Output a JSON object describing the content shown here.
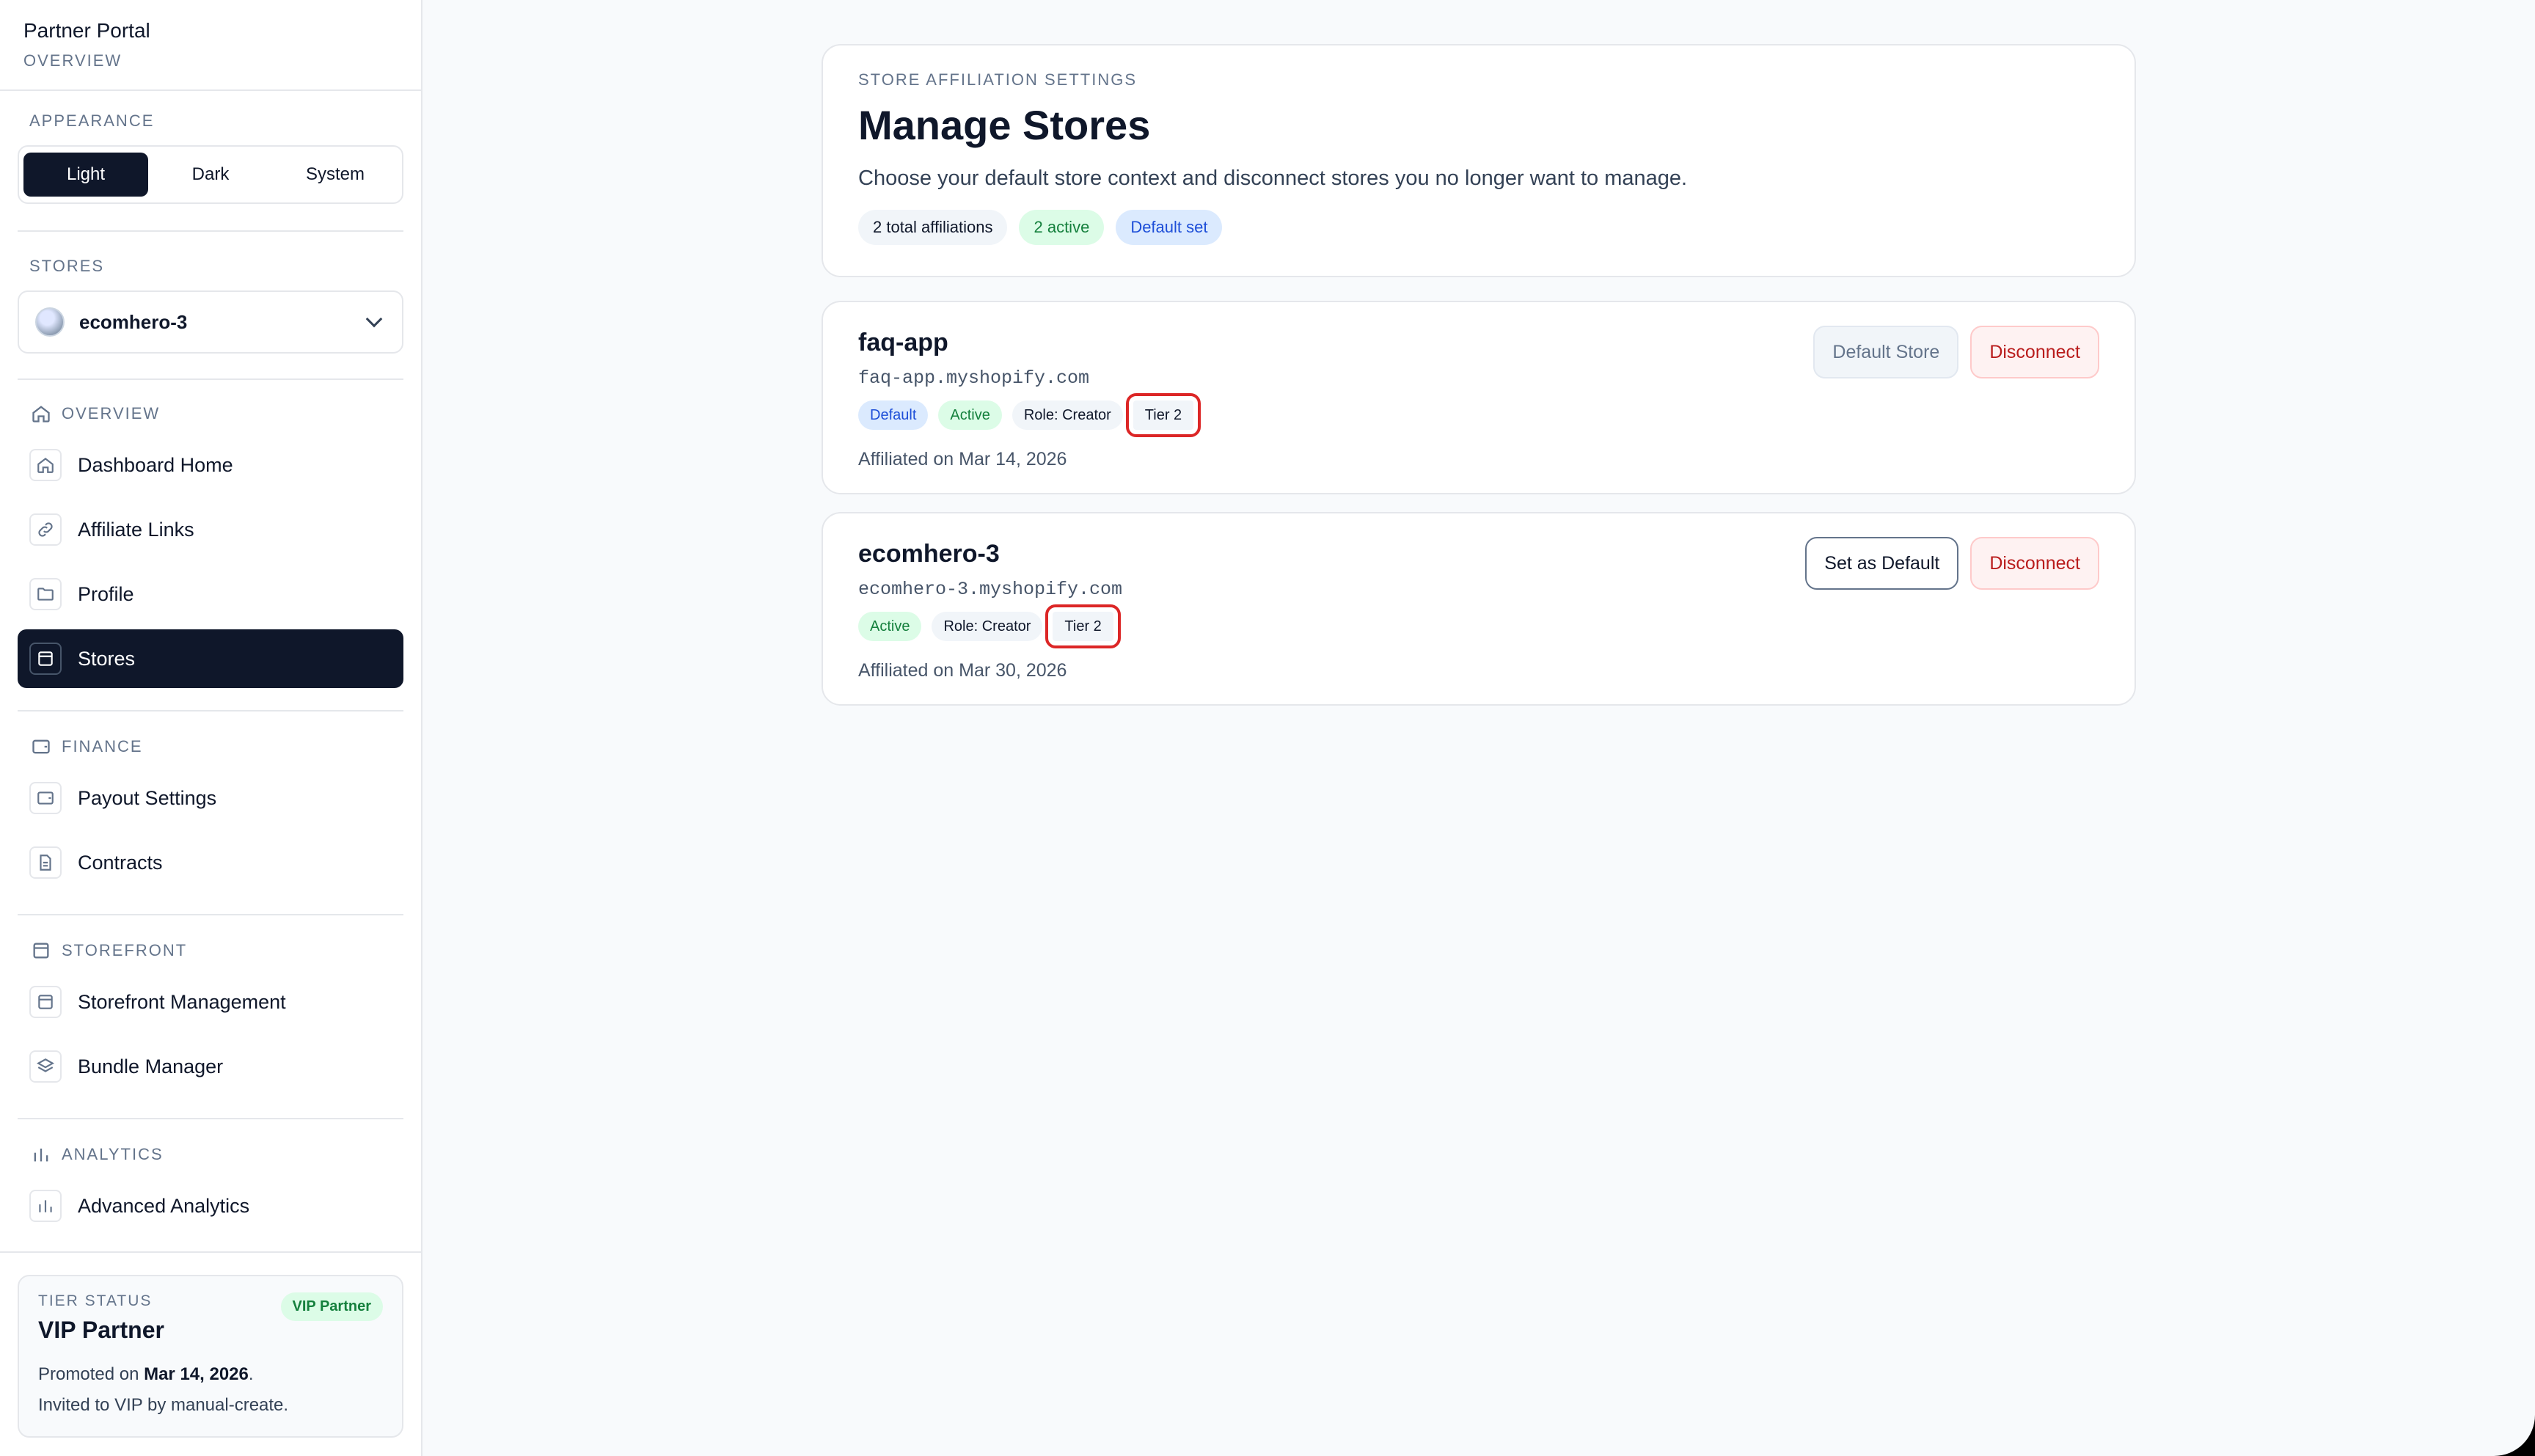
{
  "sidebar": {
    "brand_title": "Partner Portal",
    "brand_subtitle": "OVERVIEW",
    "appearance": {
      "label": "APPEARANCE",
      "options": [
        "Light",
        "Dark",
        "System"
      ],
      "selected": "Light"
    },
    "stores": {
      "label": "STORES",
      "selected": "ecomhero-3"
    },
    "groups": [
      {
        "label": "OVERVIEW",
        "icon": "home-icon",
        "items": [
          {
            "label": "Dashboard Home",
            "icon": "home-icon"
          },
          {
            "label": "Affiliate Links",
            "icon": "link-icon"
          },
          {
            "label": "Profile",
            "icon": "folder-icon"
          },
          {
            "label": "Stores",
            "icon": "store-icon",
            "active": true
          }
        ]
      },
      {
        "label": "FINANCE",
        "icon": "wallet-icon",
        "items": [
          {
            "label": "Payout Settings",
            "icon": "wallet-icon"
          },
          {
            "label": "Contracts",
            "icon": "document-icon"
          }
        ]
      },
      {
        "label": "STOREFRONT",
        "icon": "store-icon",
        "items": [
          {
            "label": "Storefront Management",
            "icon": "store-icon"
          },
          {
            "label": "Bundle Manager",
            "icon": "layers-icon"
          }
        ]
      },
      {
        "label": "ANALYTICS",
        "icon": "bar-chart-icon",
        "items": [
          {
            "label": "Advanced Analytics",
            "icon": "bar-chart-icon"
          }
        ]
      }
    ],
    "tier": {
      "label": "TIER STATUS",
      "badge": "VIP Partner",
      "name": "VIP Partner",
      "promoted_prefix": "Promoted on ",
      "promoted_date": "Mar 14, 2026",
      "promoted_suffix": ".",
      "invited": "Invited to VIP by manual-create."
    }
  },
  "header": {
    "eyebrow": "STORE AFFILIATION SETTINGS",
    "title": "Manage Stores",
    "description": "Choose your default store context and disconnect stores you no longer want to manage.",
    "chips": [
      "2 total affiliations",
      "2 active",
      "Default set"
    ]
  },
  "stores": [
    {
      "name": "faq-app",
      "domain": "faq-app.myshopify.com",
      "badges": {
        "default": "Default",
        "status": "Active",
        "role": "Role: Creator",
        "tier": "Tier 2"
      },
      "affiliated": "Affiliated on Mar 14, 2026",
      "primary_action": "Default Store",
      "disconnect": "Disconnect"
    },
    {
      "name": "ecomhero-3",
      "domain": "ecomhero-3.myshopify.com",
      "badges": {
        "status": "Active",
        "role": "Role: Creator",
        "tier": "Tier 2"
      },
      "affiliated": "Affiliated on Mar 30, 2026",
      "primary_action": "Set as Default",
      "disconnect": "Disconnect"
    }
  ],
  "colors": {
    "accent_dark": "#0f172a",
    "success": "#15803d",
    "info": "#1d4ed8",
    "danger": "#b91c1c",
    "highlight_box": "#dc2626"
  }
}
